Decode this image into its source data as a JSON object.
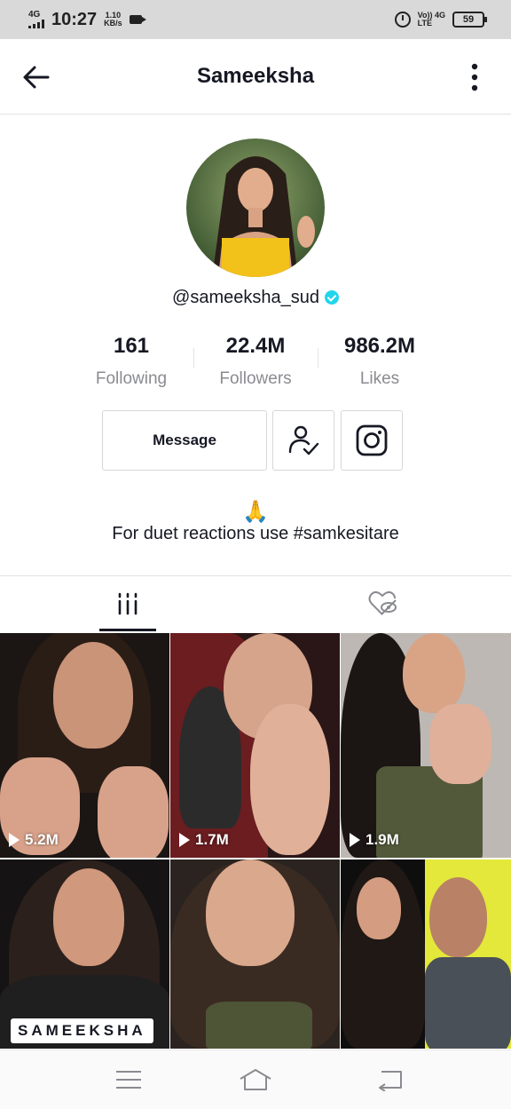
{
  "status_bar": {
    "network": "4G",
    "time": "10:27",
    "speed_value": "1.10",
    "speed_unit": "KB/s",
    "volte_top": "Vo)) 4G",
    "volte_bottom": "LTE",
    "battery": "59"
  },
  "header": {
    "title": "Sameeksha",
    "back_icon": "arrow-left-icon",
    "more_icon": "more-vertical-icon"
  },
  "profile": {
    "username": "@sameeksha_sud",
    "verified_icon": "verified-badge-icon",
    "stats": [
      {
        "value": "161",
        "label": "Following"
      },
      {
        "value": "22.4M",
        "label": "Followers"
      },
      {
        "value": "986.2M",
        "label": "Likes"
      }
    ],
    "message_label": "Message",
    "follow_icon": "user-check-icon",
    "instagram_icon": "instagram-icon",
    "bio_emoji": "🙏",
    "bio": "For duet reactions use #samkesitare"
  },
  "tabs": [
    {
      "icon": "videos-grid-icon",
      "active": true
    },
    {
      "icon": "liked-private-icon",
      "active": false
    }
  ],
  "videos": [
    {
      "views": "5.2M"
    },
    {
      "views": "1.7M"
    },
    {
      "views": "1.9M"
    },
    {
      "views": "",
      "caption": "SAMEEKSHA"
    },
    {
      "views": ""
    },
    {
      "views": ""
    }
  ],
  "colors": {
    "accent_verified": "#20d5ec",
    "text_primary": "#161823",
    "text_secondary": "#8a8b91"
  }
}
